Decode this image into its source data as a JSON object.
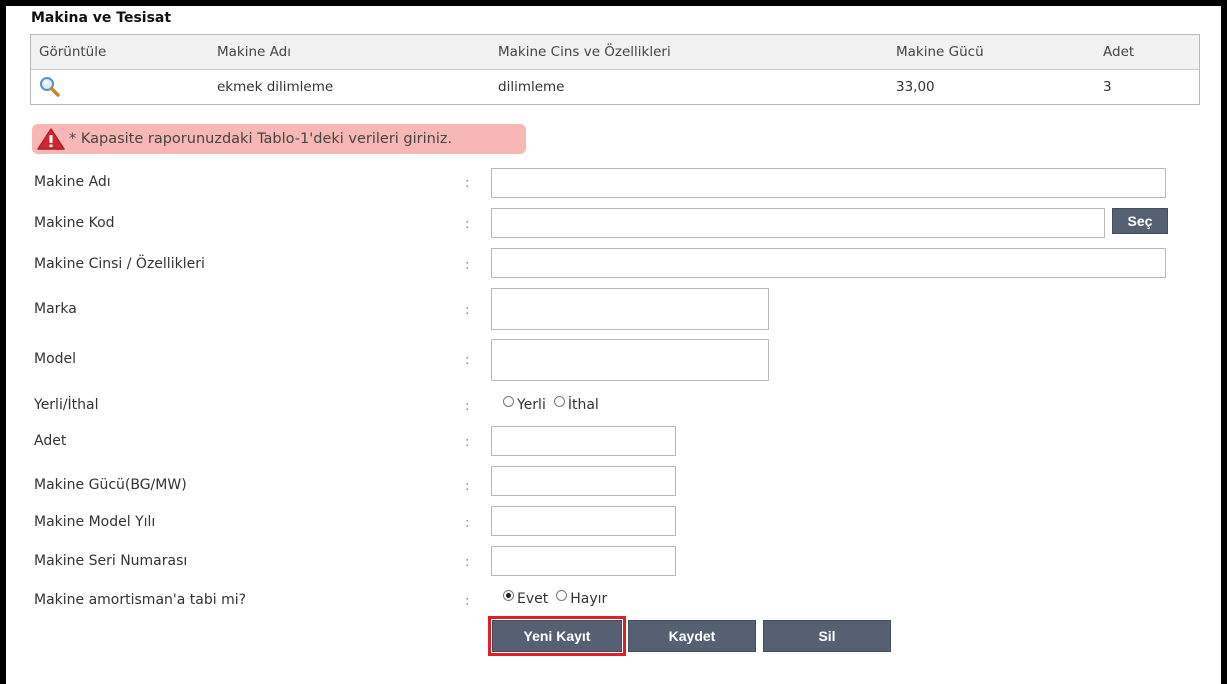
{
  "section": {
    "title": "Makina ve Tesisat"
  },
  "table": {
    "headers": [
      "Görüntüle",
      "Makine Adı",
      "Makine Cins ve Özellikleri",
      "Makine Gücü",
      "Adet"
    ],
    "rows": [
      {
        "makine_adi": "ekmek dilimleme",
        "cins": "dilimleme",
        "guc": "33,00",
        "adet": "3",
        "view_icon": "magnifier-icon"
      }
    ]
  },
  "warning": {
    "text": "* Kapasite raporunuzdaki Tablo-1'deki verileri giriniz.",
    "color": "#f7b7b5",
    "icon": "warning-triangle-icon"
  },
  "form": {
    "colon": ":",
    "makine_adi": {
      "label": "Makine Adı",
      "value": ""
    },
    "makine_kod": {
      "label": "Makine Kod",
      "value": "",
      "button": "Seç"
    },
    "makine_cinsi": {
      "label": "Makine Cinsi / Özellikleri",
      "value": ""
    },
    "marka": {
      "label": "Marka",
      "value": ""
    },
    "model": {
      "label": "Model",
      "value": ""
    },
    "yerli_ithal": {
      "label": "Yerli/İthal",
      "options": [
        "Yerli",
        "İthal"
      ],
      "selected": null
    },
    "adet": {
      "label": "Adet",
      "value": ""
    },
    "guc": {
      "label": "Makine Gücü(BG/MW)",
      "value": ""
    },
    "model_yili": {
      "label": "Makine Model Yılı",
      "value": ""
    },
    "seri_no": {
      "label": "Makine Seri Numarası",
      "value": ""
    },
    "amortisman": {
      "label": "Makine amortisman'a tabi mi?",
      "options": [
        "Evet",
        "Hayır"
      ],
      "selected": "Evet"
    }
  },
  "buttons": {
    "new": "Yeni Kayıt",
    "save": "Kaydet",
    "delete": "Sil"
  },
  "colors": {
    "button": "#556172",
    "highlight": "#e01e25"
  }
}
